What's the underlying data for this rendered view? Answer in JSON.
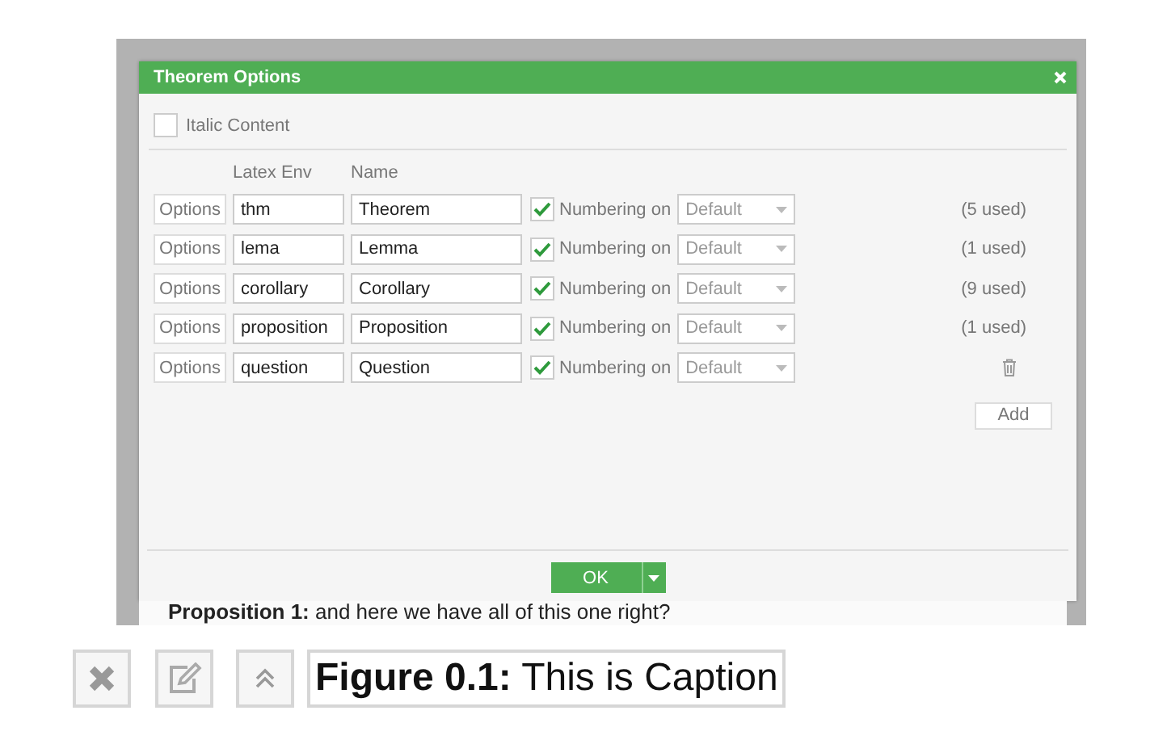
{
  "window": {
    "title": "Theorem Options"
  },
  "italic_content": {
    "label": "Italic Content",
    "checked": false
  },
  "columns": [
    "Latex Env",
    "Name"
  ],
  "rows": [
    {
      "options": "Options",
      "env": "thm",
      "name": "Theorem",
      "numbering": true,
      "numbering_label": "Numbering on",
      "counter": "Default",
      "kind": "used",
      "used": "(5 used)"
    },
    {
      "options": "Options",
      "env": "lema",
      "name": "Lemma",
      "numbering": true,
      "numbering_label": "Numbering on",
      "counter": "Default",
      "kind": "used",
      "used": "(1 used)"
    },
    {
      "options": "Options",
      "env": "corollary",
      "name": "Corollary",
      "numbering": true,
      "numbering_label": "Numbering on",
      "counter": "Default",
      "kind": "used",
      "used": "(9 used)"
    },
    {
      "options": "Options",
      "env": "proposition",
      "name": "Proposition",
      "numbering": true,
      "numbering_label": "Numbering on",
      "counter": "Default",
      "kind": "used",
      "used": "(1 used)"
    },
    {
      "options": "Options",
      "env": "question",
      "name": "Question",
      "numbering": true,
      "numbering_label": "Numbering on",
      "counter": "Default",
      "kind": "deletable"
    }
  ],
  "add_button": "Add",
  "ok_button": "OK",
  "background_text": "**Proposition 1:** and here we have all of this one right?",
  "caption": "**Figure 0.1:** This is Caption"
}
